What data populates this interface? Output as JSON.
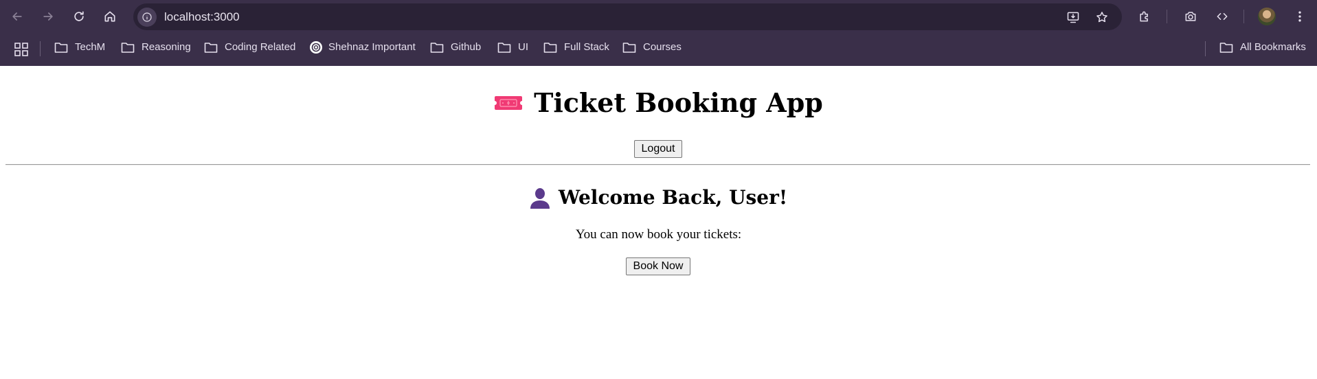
{
  "browser": {
    "url": "localhost:3000",
    "bookmarks": [
      {
        "label": "TechM",
        "icon": "folder-icon"
      },
      {
        "label": "Reasoning",
        "icon": "folder-icon"
      },
      {
        "label": "Coding Related",
        "icon": "folder-icon"
      },
      {
        "label": "Shehnaz Important",
        "icon": "openai-icon"
      },
      {
        "label": "Github",
        "icon": "folder-icon"
      },
      {
        "label": "UI",
        "icon": "folder-icon"
      },
      {
        "label": "Full Stack",
        "icon": "folder-icon"
      },
      {
        "label": "Courses",
        "icon": "folder-icon"
      }
    ],
    "all_bookmarks": "All Bookmarks",
    "theme_color": "#3a2f49"
  },
  "page": {
    "title": "Ticket Booking App",
    "logout_label": "Logout",
    "welcome": "Welcome Back, User!",
    "subtitle": "You can now book your tickets:",
    "book_label": "Book Now",
    "ticket_icon_color": "#f03a74",
    "user_icon_color": "#5b3a8c"
  }
}
